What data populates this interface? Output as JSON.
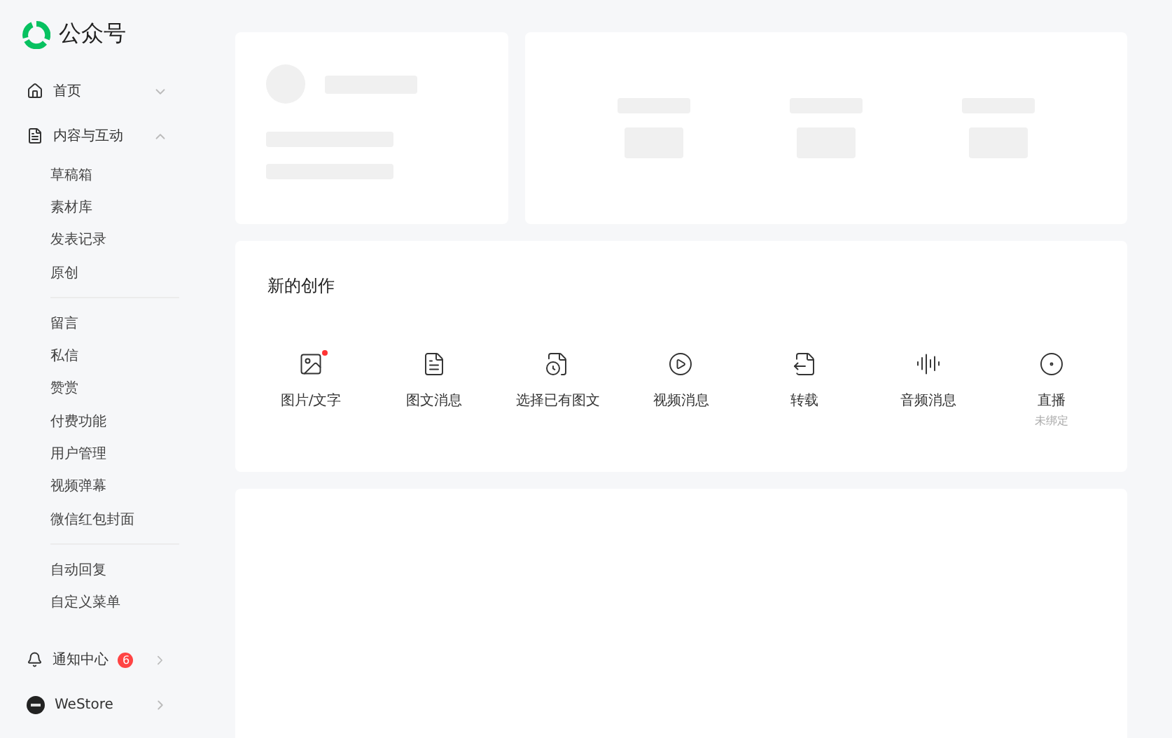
{
  "brand": {
    "title": "公众号"
  },
  "nav": [
    {
      "label": "首页",
      "kind": "home",
      "expanded": false
    },
    {
      "label": "内容与互动",
      "kind": "doc",
      "expanded": true,
      "groups": [
        {
          "children": [
            {
              "label": "草稿箱"
            },
            {
              "label": "素材库"
            },
            {
              "label": "发表记录"
            },
            {
              "label": "原创"
            }
          ]
        },
        {
          "children": [
            {
              "label": "留言"
            },
            {
              "label": "私信"
            },
            {
              "label": "赞赏"
            },
            {
              "label": "付费功能"
            },
            {
              "label": "用户管理"
            },
            {
              "label": "视频弹幕"
            },
            {
              "label": "微信红包封面"
            }
          ]
        },
        {
          "children": [
            {
              "label": "自动回复"
            },
            {
              "label": "自定义菜单"
            }
          ]
        }
      ]
    }
  ],
  "notifications": {
    "label": "通知中心",
    "badge": "6"
  },
  "store": {
    "label": "WeStore"
  },
  "create": {
    "title": "新的创作",
    "actions": [
      {
        "label": "图片/文字",
        "kind": "image",
        "unread": true
      },
      {
        "label": "图文消息",
        "kind": "doc",
        "unread": false
      },
      {
        "label": "选择已有图文",
        "kind": "history",
        "unread": false
      },
      {
        "label": "视频消息",
        "kind": "video",
        "unread": false
      },
      {
        "label": "转载",
        "kind": "repost",
        "unread": false
      },
      {
        "label": "音频消息",
        "kind": "audio",
        "unread": false
      },
      {
        "label": "直播",
        "kind": "live",
        "unread": false,
        "note": "未绑定"
      }
    ]
  }
}
